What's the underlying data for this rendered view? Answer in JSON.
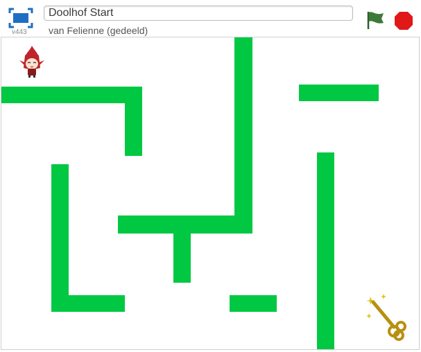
{
  "header": {
    "project_title": "Doolhof Start",
    "author": "van Felienne (gedeeld)",
    "version": "v443"
  },
  "controls": {
    "fullscreen_icon": "fullscreen-icon",
    "green_flag_icon": "green-flag-icon",
    "stop_icon": "stop-icon"
  },
  "stage": {
    "wall_color": "#00c843",
    "sprites": [
      "player-sprite",
      "key-sprite"
    ]
  },
  "colors": {
    "accent_blue": "#1e6fc2",
    "flag_green": "#3d7a3a",
    "stop_red": "#e01818",
    "key_gold": "#b8900f"
  }
}
